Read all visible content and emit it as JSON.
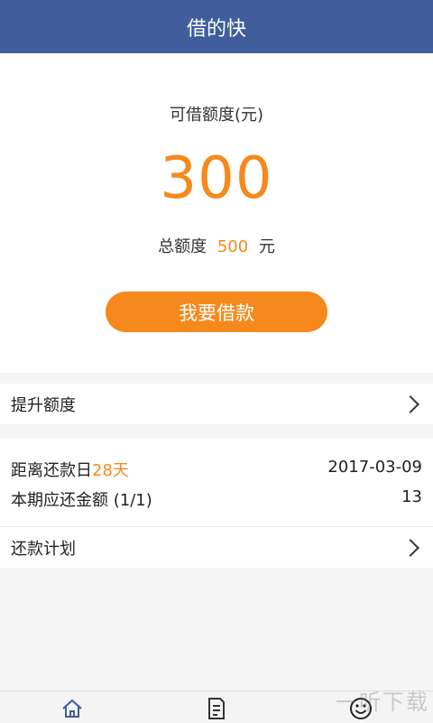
{
  "header": {
    "title": "借的快"
  },
  "quota": {
    "label": "可借额度(元)",
    "amount": "300",
    "total_prefix": "总额度",
    "total_value": "500",
    "total_unit": "元",
    "borrow_label": "我要借款"
  },
  "raise_limit": {
    "label": "提升额度"
  },
  "repayment": {
    "due_prefix": "距离还款日",
    "due_days": "28天",
    "due_date": "2017-03-09",
    "period_label": "本期应还金额 (1/1)",
    "period_amount": "13"
  },
  "plan": {
    "label": "还款计划"
  },
  "bottom_nav": {
    "items": [
      {
        "icon": "home-icon"
      },
      {
        "icon": "bill-icon"
      },
      {
        "icon": "smiley-icon"
      }
    ]
  },
  "watermark": {
    "text": "一听下载"
  },
  "colors": {
    "header": "#3f5e9b",
    "accent": "#f5891d"
  }
}
